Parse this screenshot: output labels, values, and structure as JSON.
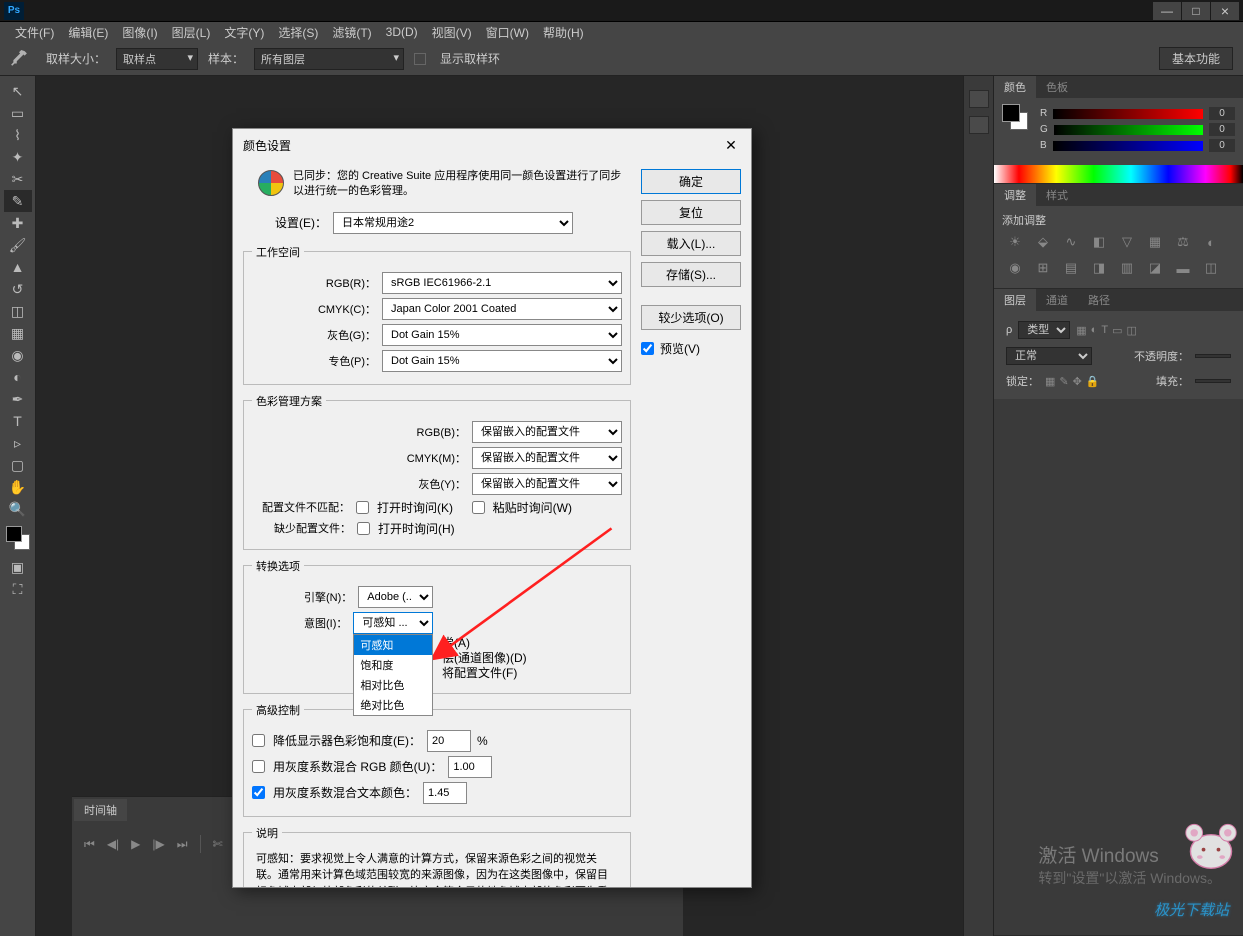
{
  "menubar": [
    "文件(F)",
    "编辑(E)",
    "图像(I)",
    "图层(L)",
    "文字(Y)",
    "选择(S)",
    "滤镜(T)",
    "3D(D)",
    "视图(V)",
    "窗口(W)",
    "帮助(H)"
  ],
  "options": {
    "sample_size_label": "取样大小：",
    "sample_size_value": "取样点",
    "sample_label": "样本：",
    "sample_value": "所有图层",
    "show_ring_label": "显示取样环",
    "right_badge": "基本功能"
  },
  "panels": {
    "color_tab": "颜色",
    "swatch_tab": "色板",
    "rgb": {
      "r": "0",
      "g": "0",
      "b": "0"
    },
    "adjust_tab": "调整",
    "style_tab": "样式",
    "add_adjust": "添加调整",
    "layers_tab": "图层",
    "channels_tab": "通道",
    "paths_tab": "路径",
    "kind_label": "类型",
    "blend": "正常",
    "opacity_label": "不透明度：",
    "lock_label": "锁定：",
    "fill_label": "填充："
  },
  "dialog": {
    "title": "颜色设置",
    "sync_text": "已同步：您的 Creative Suite 应用程序使用同一颜色设置进行了同步以进行统一的色彩管理。",
    "settings_label": "设置(E)：",
    "settings_value": "日本常规用途2",
    "workspace_legend": "工作空间",
    "rgb_label": "RGB(R)：",
    "rgb_value": "sRGB IEC61966-2.1",
    "cmyk_label": "CMYK(C)：",
    "cmyk_value": "Japan Color 2001 Coated",
    "gray_label": "灰色(G)：",
    "gray_value": "Dot Gain 15%",
    "spot_label": "专色(P)：",
    "spot_value": "Dot Gain 15%",
    "policy_legend": "色彩管理方案",
    "prgb_label": "RGB(B)：",
    "prgb_value": "保留嵌入的配置文件",
    "pcmyk_label": "CMYK(M)：",
    "pcmyk_value": "保留嵌入的配置文件",
    "pgray_label": "灰色(Y)：",
    "pgray_value": "保留嵌入的配置文件",
    "mismatch_label": "配置文件不匹配：",
    "mismatch_open": "打开时询问(K)",
    "mismatch_paste": "粘贴时询问(W)",
    "missing_label": "缺少配置文件：",
    "missing_open": "打开时询问(H)",
    "convert_legend": "转换选项",
    "engine_label": "引擎(N)：",
    "engine_value": "Adobe (...",
    "intent_label": "意图(I)：",
    "intent_value": "可感知  ...",
    "intent_options": [
      "可感知",
      "饱和度",
      "相对比色",
      "绝对比色"
    ],
    "comp_a": "尝(A)",
    "comp_d": "偿(通道图像)(D)",
    "comp_f": "将配置文件(F)",
    "advanced_legend": "高级控制",
    "adv_desat": "降低显示器色彩饱和度(E)：",
    "adv_desat_val": "20",
    "adv_pct": "%",
    "adv_blend_rgb": "用灰度系数混合 RGB 颜色(U)：",
    "adv_blend_rgb_val": "1.00",
    "adv_blend_text": "用灰度系数混合文本颜色：",
    "adv_blend_text_val": "1.45",
    "desc_legend": "说明",
    "desc_text": "可感知：要求视觉上令人满意的计算方式，保留来源色彩之间的视觉关联。通常用来计算色域范围较宽的来源图像，因为在这类图像中，保留目标色域内部与外部色彩的关联，比完全符合目的地色域内部的色彩更为重要。",
    "btn_ok": "确定",
    "btn_reset": "复位",
    "btn_load": "载入(L)...",
    "btn_save": "存储(S)...",
    "btn_less": "较少选项(O)",
    "preview": "预览(V)"
  },
  "timeline": {
    "tab": "时间轴"
  },
  "watermark": {
    "big": "激活 Windows",
    "small": "转到\"设置\"以激活 Windows。",
    "site": "极光下载站"
  }
}
